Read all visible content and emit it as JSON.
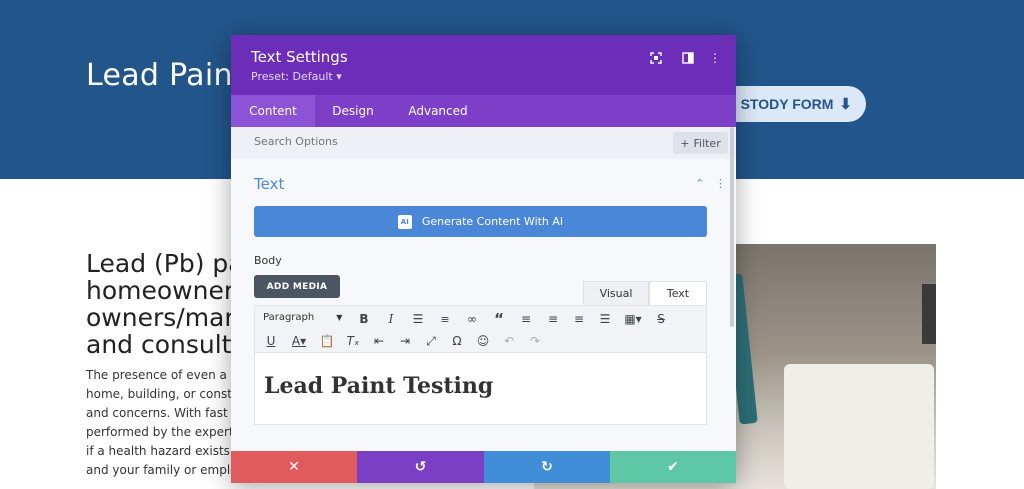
{
  "page": {
    "hero_title": "Lead Paint",
    "hero_button": "STODY FORM",
    "hero_button_icon": "download-icon",
    "heading_lines": [
      "Lead (Pb) pa",
      "homeowner",
      "owners/mar",
      "and consult"
    ],
    "paragraph_lines": [
      "The presence of even a sr",
      "home, building, or constr",
      "and concerns. With fast a",
      "performed by the experts",
      "if a health hazard exists a",
      "and your family or emplo"
    ]
  },
  "modal": {
    "title": "Text Settings",
    "preset": "Preset: Default ▾",
    "header_icons": [
      "expand-icon",
      "split-view-icon",
      "more-options-icon"
    ],
    "tabs": [
      {
        "label": "Content",
        "active": true
      },
      {
        "label": "Design",
        "active": false
      },
      {
        "label": "Advanced",
        "active": false
      }
    ],
    "search_placeholder": "Search Options",
    "filter_label": "Filter",
    "section_title": "Text",
    "ai_button": "Generate Content With AI",
    "ai_badge": "AI",
    "body_label": "Body",
    "add_media": "ADD MEDIA",
    "editor_tabs": [
      "Visual",
      "Text"
    ],
    "paragraph_select": "Paragraph",
    "toolbar_row1": [
      "bold-icon",
      "italic-icon",
      "bullet-list-icon",
      "numbered-list-icon",
      "link-icon",
      "blockquote-icon",
      "align-left-icon",
      "align-center-icon",
      "align-right-icon",
      "justify-icon",
      "table-icon",
      "strikethrough-icon"
    ],
    "toolbar_row2": [
      "underline-icon",
      "text-color-icon",
      "paste-text-icon",
      "clear-formatting-icon",
      "outdent-icon",
      "indent-icon",
      "fullscreen-icon",
      "special-character-icon",
      "emoji-icon",
      "undo-icon",
      "redo-icon"
    ],
    "editor_content": "Lead Paint Testing",
    "actions": [
      "cancel-icon",
      "undo-icon",
      "redo-icon",
      "save-icon"
    ]
  },
  "colors": {
    "hero_bg": "#22558a",
    "modal_header": "#6c2eb9",
    "tabs_bg": "#7d3fc8",
    "ai_button": "#4a87d8",
    "cancel": "#e05c5c",
    "undo": "#7b3fc6",
    "redo": "#3f8ed7",
    "save": "#5ec8a6"
  }
}
